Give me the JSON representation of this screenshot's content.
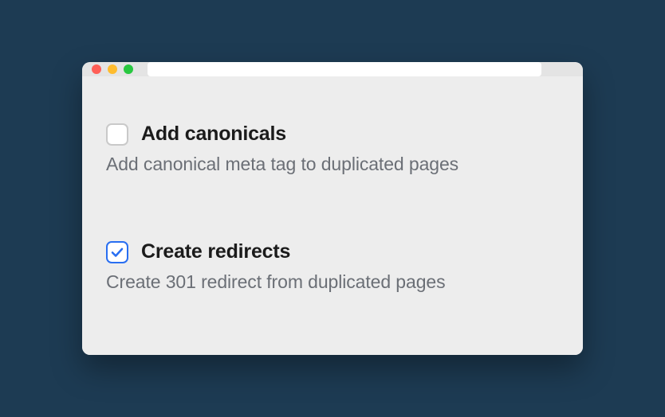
{
  "options": [
    {
      "title": "Add canonicals",
      "description": "Add canonical meta tag to duplicated pages",
      "checked": false
    },
    {
      "title": "Create redirects",
      "description": "Create 301 redirect from duplicated pages",
      "checked": true
    }
  ]
}
